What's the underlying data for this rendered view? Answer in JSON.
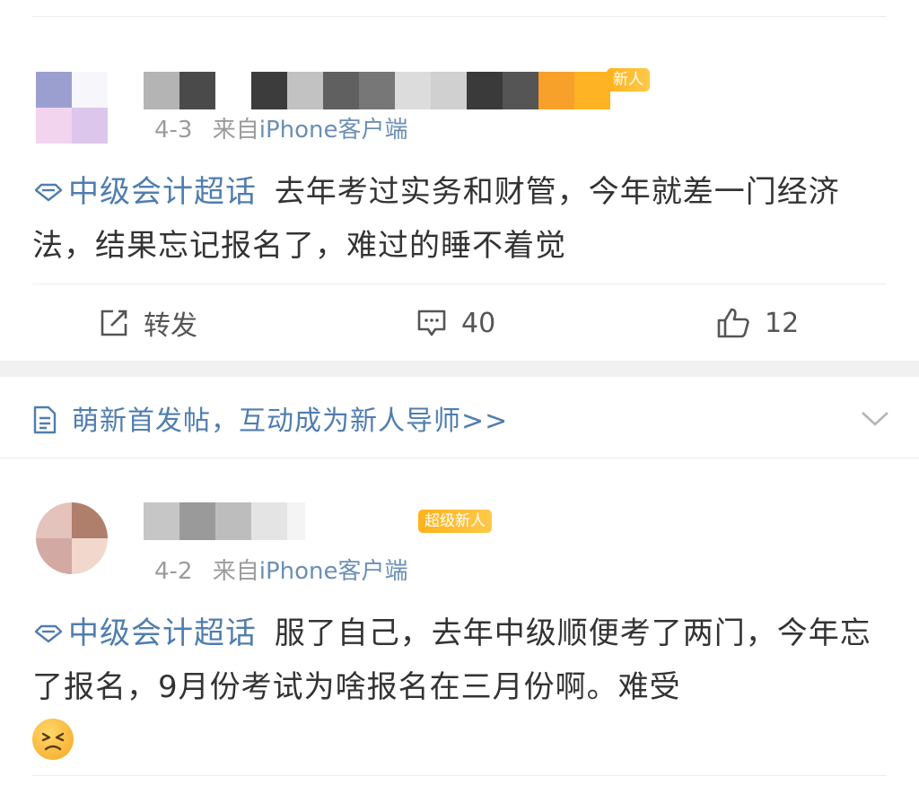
{
  "post1": {
    "badge": "新人",
    "date": "4-3",
    "source_prefix": "来自",
    "source": "iPhone客户端",
    "topic": "中级会计超话",
    "text": "去年考过实务和财管，今年就差一门经济法，结果忘记报名了，难过的睡不着觉",
    "actions": {
      "repost_label": "转发",
      "comments": "40",
      "likes": "12"
    }
  },
  "notice": {
    "text": "萌新首发帖，互动成为新人导师>>"
  },
  "post2": {
    "badge": "超级新人",
    "date": "4-2",
    "source_prefix": "来自",
    "source": "iPhone客户端",
    "topic": "中级会计超话",
    "text": "服了自己，去年中级顺便考了两门，今年忘了报名，9月份考试为啥报名在三月份啊。难受"
  },
  "icons": {
    "topic": "diamond-outline-icon",
    "repost": "share-edit-icon",
    "comment": "comment-bubble-icon",
    "like": "thumbs-up-icon",
    "notice": "document-icon",
    "expand": "chevron-down-icon",
    "emoji": "persevering-face-emoji"
  },
  "colors": {
    "link": "#507daf",
    "text": "#333333",
    "meta": "#9b9b9b",
    "badge": "#ffb21a"
  }
}
